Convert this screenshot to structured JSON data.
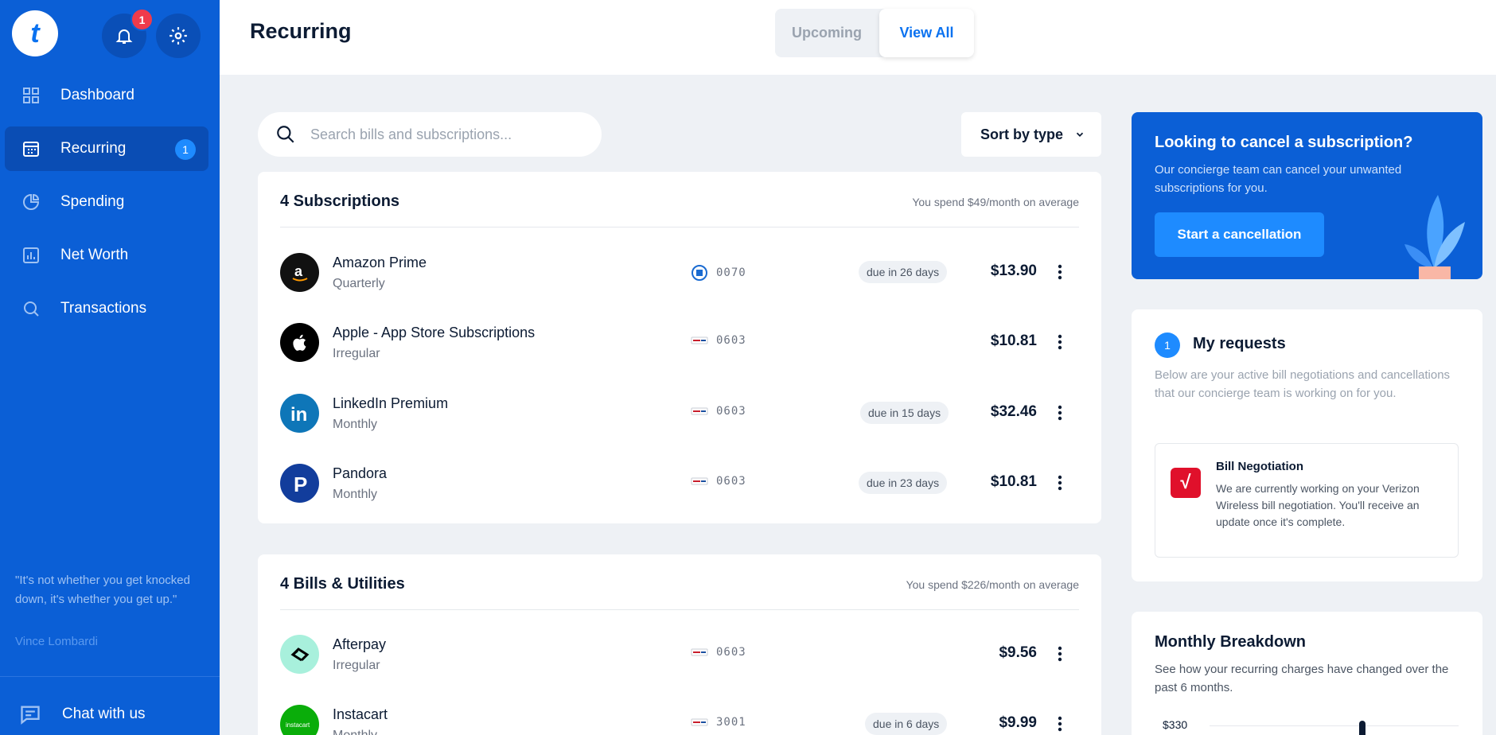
{
  "app": {
    "notification_count": "1",
    "accent": "#0b5fd6"
  },
  "sidebar": {
    "items": [
      {
        "label": "Dashboard",
        "icon": "grid-icon"
      },
      {
        "label": "Recurring",
        "icon": "calendar-icon",
        "count": "1",
        "active": true
      },
      {
        "label": "Spending",
        "icon": "pie-chart-icon"
      },
      {
        "label": "Net Worth",
        "icon": "bar-chart-icon"
      },
      {
        "label": "Transactions",
        "icon": "search-icon"
      }
    ],
    "quote": "\"It's not whether you get knocked down, it's whether you get up.\"",
    "quote_author": "Vince Lombardi",
    "chat_label": "Chat with us"
  },
  "header": {
    "title": "Recurring",
    "tabs": [
      {
        "label": "Upcoming",
        "active": false
      },
      {
        "label": "View All",
        "active": true
      }
    ]
  },
  "search": {
    "placeholder": "Search bills and subscriptions..."
  },
  "sort": {
    "label": "Sort by type"
  },
  "subscriptions": {
    "title": "4 Subscriptions",
    "average": "You spend $49/month on average",
    "rows": [
      {
        "name": "Amazon Prime",
        "frequency": "Quarterly",
        "account": "0070",
        "due": "due in 26 days",
        "amount": "$13.90",
        "icon": "amazon-logo-icon"
      },
      {
        "name": "Apple - App Store Subscriptions",
        "frequency": "Irregular",
        "account": "0603",
        "due": "",
        "amount": "$10.81",
        "icon": "apple-logo-icon"
      },
      {
        "name": "LinkedIn Premium",
        "frequency": "Monthly",
        "account": "0603",
        "due": "due in 15 days",
        "amount": "$32.46",
        "icon": "linkedin-logo-icon"
      },
      {
        "name": "Pandora",
        "frequency": "Monthly",
        "account": "0603",
        "due": "due in 23 days",
        "amount": "$10.81",
        "icon": "pandora-logo-icon"
      }
    ]
  },
  "bills": {
    "title": "4 Bills & Utilities",
    "average": "You spend $226/month on average",
    "rows": [
      {
        "name": "Afterpay",
        "frequency": "Irregular",
        "account": "0603",
        "due": "",
        "amount": "$9.56",
        "icon": "afterpay-logo-icon"
      },
      {
        "name": "Instacart",
        "frequency": "Monthly",
        "account": "3001",
        "due": "due in 6 days",
        "amount": "$9.99",
        "icon": "instacart-logo-icon"
      }
    ]
  },
  "cancel_card": {
    "title": "Looking to cancel a subscription?",
    "description": "Our concierge team can cancel your unwanted subscriptions for you.",
    "button": "Start a cancellation"
  },
  "requests": {
    "count": "1",
    "title": "My requests",
    "description": "Below are your active bill negotiations and cancellations that our concierge team is working on for you.",
    "item_title": "Bill Negotiation",
    "item_logo": "√",
    "item_description": "We are currently working on your Verizon Wireless bill negotiation. You'll receive an update once it's complete."
  },
  "breakdown": {
    "title": "Monthly Breakdown",
    "description": "See how your recurring charges have changed over the past 6 months.",
    "top_tick": "$330"
  }
}
